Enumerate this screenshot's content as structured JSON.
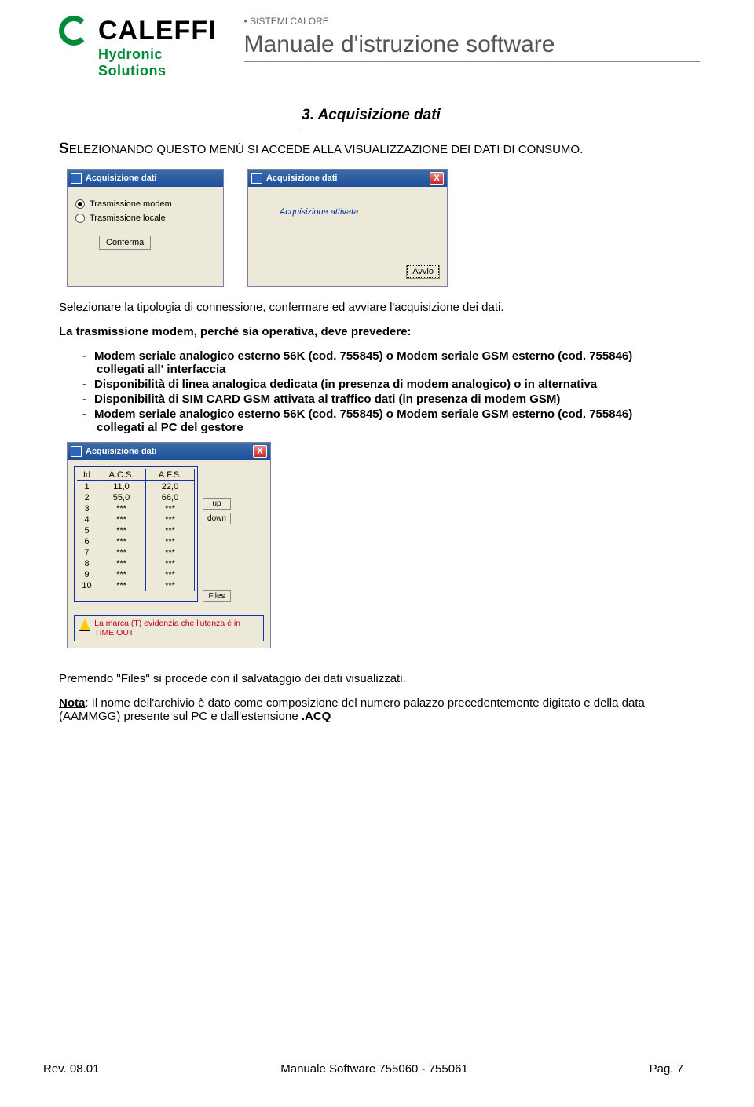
{
  "header": {
    "brand": "CALEFFI",
    "tagline": "Hydronic Solutions",
    "sistemi": "• SISTEMI CALORE",
    "manual_title": "Manuale d'istruzione software"
  },
  "section": {
    "title": "3. Acquisizione dati",
    "intro_firstchar": "S",
    "intro_rest": "ELEZIONANDO QUESTO MENÙ SI ACCEDE ALLA VISUALIZZAZIONE DEI DATI DI CONSUMO."
  },
  "win1": {
    "title": "Acquisizione dati",
    "radio_modem": "Trasmissione   modem",
    "radio_locale": "Trasmissione   locale",
    "confirm": "Conferma"
  },
  "win2": {
    "title": "Acquisizione dati",
    "msg": "Acquisizione attivata",
    "avvio": "Avvio",
    "close": "X"
  },
  "para1": "Selezionare la tipologia di connessione,  confermare ed avviare l'acquisizione dei dati.",
  "para2": "La trasmissione modem, perché sia operativa, deve prevedere:",
  "bullets": [
    "Modem seriale analogico esterno 56K (cod. 755845) o Modem seriale GSM esterno (cod. 755846) collegati all' interfaccia",
    "Disponibilità di linea analogica dedicata (in presenza di modem analogico) o in alternativa",
    "Disponibilità di SIM CARD GSM attivata al traffico dati (in presenza di modem GSM)",
    "Modem seriale analogico esterno 56K (cod. 755845) o Modem seriale GSM esterno (cod. 755846) collegati al PC del gestore"
  ],
  "win3": {
    "title": "Acquisizione   dati",
    "close": "X",
    "headers": {
      "id": "Id",
      "acs": "A.C.S.",
      "afs": "A.F.S."
    },
    "rows": [
      {
        "id": "1",
        "a": "11,0",
        "b": "22,0"
      },
      {
        "id": "2",
        "a": "55,0",
        "b": "66,0"
      },
      {
        "id": "3",
        "a": "***",
        "b": "***"
      },
      {
        "id": "4",
        "a": "***",
        "b": "***"
      },
      {
        "id": "5",
        "a": "***",
        "b": "***"
      },
      {
        "id": "6",
        "a": "***",
        "b": "***"
      },
      {
        "id": "7",
        "a": "***",
        "b": "***"
      },
      {
        "id": "8",
        "a": "***",
        "b": "***"
      },
      {
        "id": "9",
        "a": "***",
        "b": "***"
      },
      {
        "id": "10",
        "a": "***",
        "b": "***"
      }
    ],
    "btn_up": "up",
    "btn_down": "down",
    "btn_files": "Files",
    "warn": "La marca (T) evidenzia che l'utenza é in TIME OUT."
  },
  "after1": "Premendo \"Files\" si procede con il salvataggio dei dati visualizzati.",
  "after2_pre": "Nota",
  "after2_mid": ": Il nome dell'archivio è dato come composizione del numero palazzo precedentemente digitato e della data (AAMMGG) presente sul PC e dall'estensione ",
  "after2_ext": ".ACQ",
  "footer": {
    "rev": "Rev. 08.01",
    "center": "Manuale Software 755060 - 755061",
    "page": "Pag. 7"
  }
}
